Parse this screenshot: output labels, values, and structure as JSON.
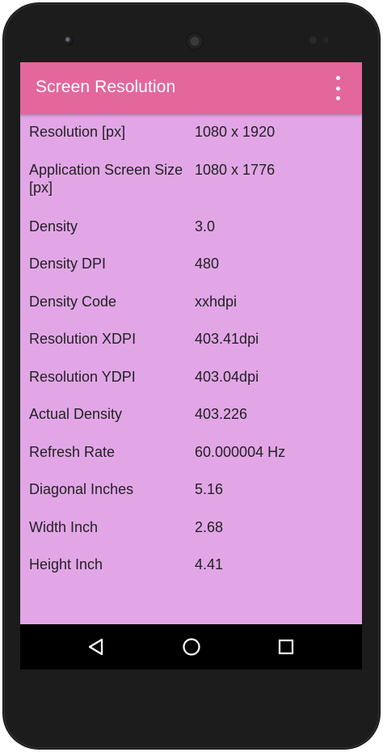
{
  "app_bar": {
    "title": "Screen Resolution",
    "overflow_icon": "more-vert-icon"
  },
  "rows": [
    {
      "label": "Resolution [px]",
      "value": "1080 x 1920"
    },
    {
      "label": "Application Screen Size [px]",
      "value": "1080 x 1776"
    },
    {
      "label": "Density",
      "value": "3.0"
    },
    {
      "label": "Density DPI",
      "value": "480"
    },
    {
      "label": "Density Code",
      "value": "xxhdpi"
    },
    {
      "label": "Resolution XDPI",
      "value": "403.41dpi"
    },
    {
      "label": "Resolution YDPI",
      "value": "403.04dpi"
    },
    {
      "label": "Actual Density",
      "value": "403.226"
    },
    {
      "label": "Refresh Rate",
      "value": "60.000004 Hz"
    },
    {
      "label": "Diagonal Inches",
      "value": "5.16"
    },
    {
      "label": "Width Inch",
      "value": "2.68"
    },
    {
      "label": "Height Inch",
      "value": "4.41"
    }
  ],
  "nav_bar": {
    "back_icon": "back-triangle-icon",
    "home_icon": "home-circle-icon",
    "recents_icon": "recents-square-icon"
  },
  "colors": {
    "app_bar": "#e3679b",
    "background": "#e2a6e7",
    "text": "#222222"
  }
}
